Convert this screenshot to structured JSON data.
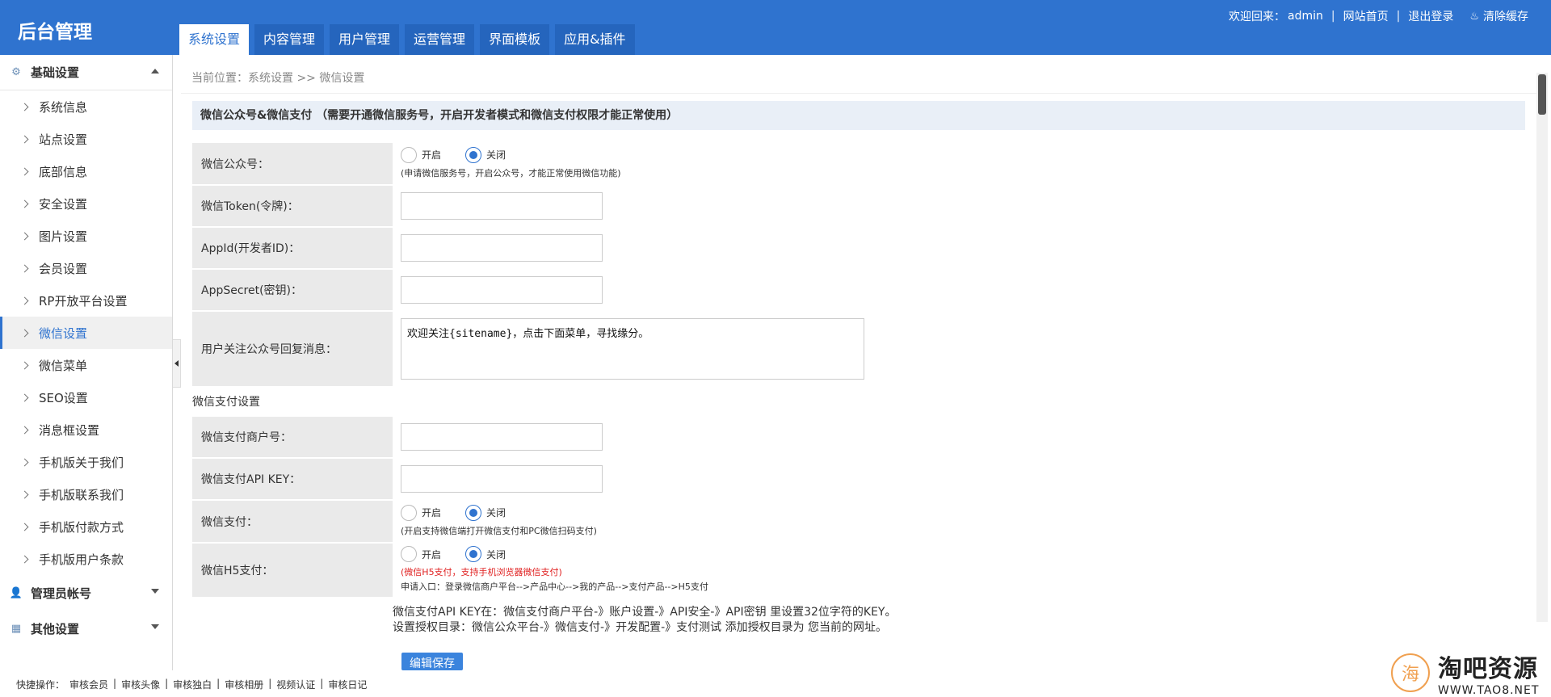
{
  "header": {
    "logo": "后台管理",
    "tabs": [
      {
        "label": "系统设置"
      },
      {
        "label": "内容管理"
      },
      {
        "label": "用户管理"
      },
      {
        "label": "运营管理"
      },
      {
        "label": "界面模板"
      },
      {
        "label": "应用&插件"
      }
    ],
    "welcome": "欢迎回来：",
    "username": "admin",
    "site_home": "网站首页",
    "logout": "退出登录",
    "clear_cache": "清除缓存"
  },
  "sidebar": {
    "group_basic": "基础设置",
    "items": [
      {
        "label": "系统信息"
      },
      {
        "label": "站点设置"
      },
      {
        "label": "底部信息"
      },
      {
        "label": "安全设置"
      },
      {
        "label": "图片设置"
      },
      {
        "label": "会员设置"
      },
      {
        "label": "RP开放平台设置"
      },
      {
        "label": "微信设置"
      },
      {
        "label": "微信菜单"
      },
      {
        "label": "SEO设置"
      },
      {
        "label": "消息框设置"
      },
      {
        "label": "手机版关于我们"
      },
      {
        "label": "手机版联系我们"
      },
      {
        "label": "手机版付款方式"
      },
      {
        "label": "手机版用户条款"
      }
    ],
    "active_index": 7,
    "group_admin": "管理员帐号",
    "group_other": "其他设置"
  },
  "breadcrumb": "当前位置：系统设置 >> 微信设置",
  "form": {
    "section_title": "微信公众号&微信支付 （需要开通微信服务号，开启开发者模式和微信支付权限才能正常使用）",
    "mp_label": "微信公众号：",
    "radio_on": "开启",
    "radio_off": "关闭",
    "mp_hint": "(申请微信服务号，开启公众号，才能正常使用微信功能)",
    "token_label": "微信Token(令牌)：",
    "appid_label": "AppId(开发者ID)：",
    "appsecret_label": "AppSecret(密钥)：",
    "reply_label": "用户关注公众号回复消息：",
    "reply_value": "欢迎关注{sitename}，点击下面菜单，寻找缘分。",
    "pay_section": "微信支付设置",
    "mchid_label": "微信支付商户号：",
    "apikey_label": "微信支付API KEY：",
    "pay_label": "微信支付：",
    "pay_hint": "(开启支持微信端打开微信支付和PC微信扫码支付)",
    "h5_label": "微信H5支付：",
    "h5_hint_red": "(微信H5支付，支持手机浏览器微信支付)",
    "h5_hint": "申请入口：登录微信商户平台-->产品中心-->我的产品-->支付产品-->H5支付",
    "note1": "微信支付API KEY在：微信支付商户平台-》账户设置-》API安全-》API密钥 里设置32位字符的KEY。",
    "note2": "设置授权目录：微信公众平台-》微信支付-》开发配置-》支付测试 添加授权目录为 您当前的网址。",
    "save": "编辑保存"
  },
  "quick": {
    "label": "快捷操作：",
    "links": [
      "审核会员",
      "审核头像",
      "审核独白",
      "审核相册",
      "视频认证",
      "审核日记"
    ]
  },
  "watermark": {
    "cn": "淘吧资源",
    "en": "WWW.TAO8.NET",
    "icon": "海"
  }
}
